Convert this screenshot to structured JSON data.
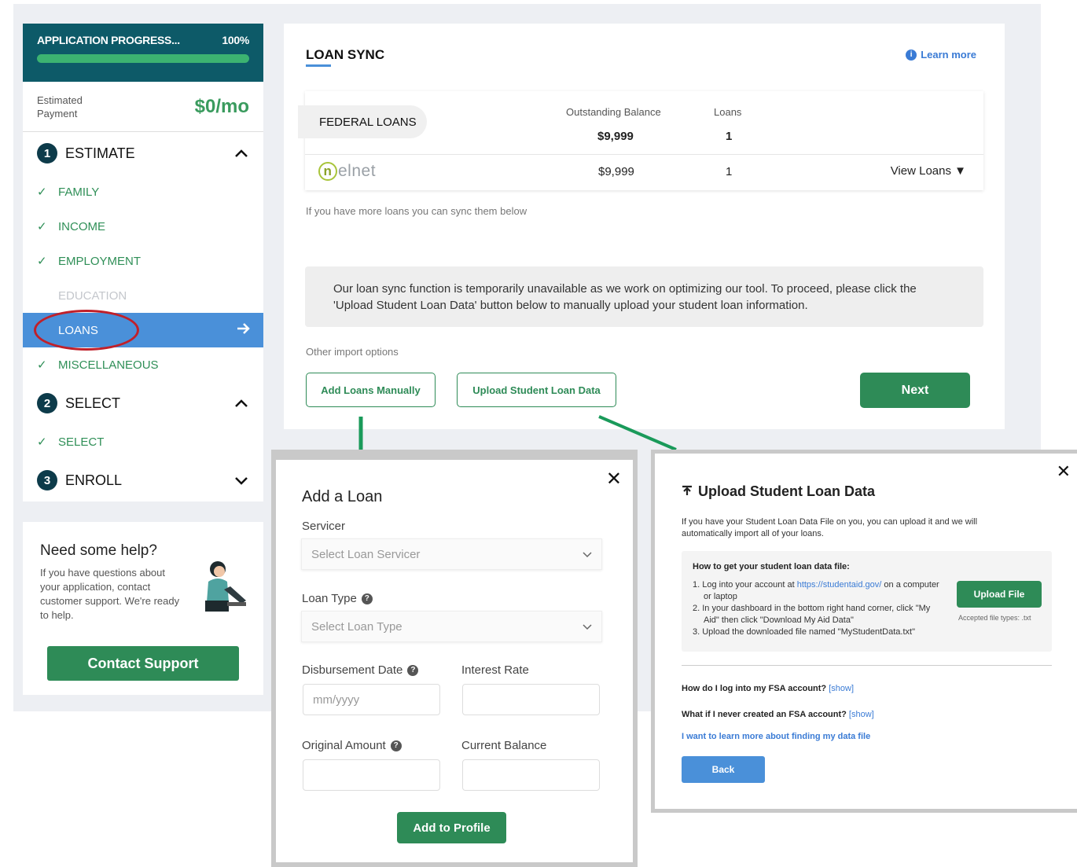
{
  "sidebar": {
    "progress": {
      "label": "APPLICATION PROGRESS...",
      "percent_text": "100%",
      "percent": 100
    },
    "estimate": {
      "label": "Estimated Payment",
      "value": "$0/mo"
    },
    "steps": [
      {
        "num": "1",
        "title": "ESTIMATE",
        "expanded": true
      },
      {
        "num": "2",
        "title": "SELECT",
        "expanded": true
      },
      {
        "num": "3",
        "title": "ENROLL",
        "expanded": false
      }
    ],
    "estimate_items": [
      "FAMILY",
      "INCOME",
      "EMPLOYMENT",
      "EDUCATION",
      "LOANS",
      "MISCELLANEOUS"
    ],
    "select_items": [
      "SELECT"
    ]
  },
  "help": {
    "title": "Need some help?",
    "text": "If you have questions about your application, contact customer support. We're ready to help.",
    "button": "Contact Support"
  },
  "main": {
    "title": "LOAN SYNC",
    "learn_more": "Learn more",
    "federal_label": "FEDERAL LOANS",
    "col_balance": "Outstanding Balance",
    "col_loans": "Loans",
    "total_balance": "$9,999",
    "total_loans": "1",
    "servicer_name": "elnet",
    "servicer_balance": "$9,999",
    "servicer_loans": "1",
    "view_loans": "View Loans ▼",
    "sync_note": "If you have more loans you can sync them below",
    "unavailable": "Our loan sync function is temporarily unavailable as we work on optimizing our tool. To proceed, please click the 'Upload Student Loan Data' button below to manually upload your student loan information.",
    "other_options": "Other import options",
    "add_manual": "Add Loans Manually",
    "upload_data": "Upload Student Loan Data",
    "next": "Next"
  },
  "add_modal": {
    "title": "Add a Loan",
    "servicer_label": "Servicer",
    "servicer_placeholder": "Select Loan Servicer",
    "type_label": "Loan Type",
    "type_placeholder": "Select Loan Type",
    "disb_label": "Disbursement Date",
    "disb_placeholder": "mm/yyyy",
    "rate_label": "Interest Rate",
    "orig_label": "Original Amount",
    "bal_label": "Current Balance",
    "submit": "Add to Profile"
  },
  "upload_modal": {
    "title": "Upload Student Loan Data",
    "desc": "If you have your Student Loan Data File on you, you can upload it and we will automatically import all of your loans.",
    "how_title": "How to get your student loan data file:",
    "step1_pre": "1. Log into your account at ",
    "step1_link": "https://studentaid.gov/",
    "step1_post": " on a computer or laptop",
    "step2": "2. In your dashboard in the bottom right hand corner, click \"My Aid\" then click \"Download My Aid Data\"",
    "step3": "3. Upload the downloaded file named \"MyStudentData.txt\"",
    "upload_btn": "Upload File",
    "types": "Accepted file types: .txt",
    "q1": "How do I log into my FSA account?",
    "q2": "What if I never created an FSA account?",
    "show": "[show]",
    "learn": "I want to learn more about finding my data file",
    "back": "Back"
  }
}
